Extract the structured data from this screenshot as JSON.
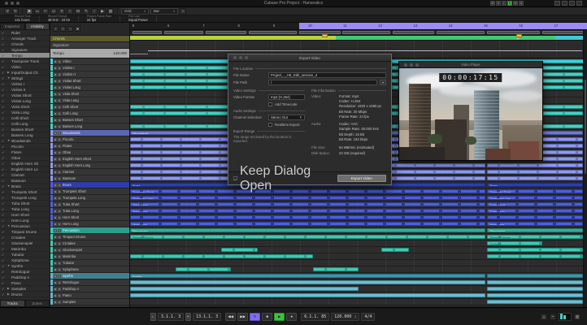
{
  "titlebar": {
    "title": "Cubase Pro Project - Hanseatics",
    "letter_buttons": [
      "M",
      "S",
      "L",
      "R",
      "W",
      "A"
    ],
    "active_letter_index": 3
  },
  "toolbar": {
    "tools": [
      {
        "name": "pointer-tool",
        "glyph": "➤"
      },
      {
        "name": "range-tool",
        "glyph": "▭"
      },
      {
        "name": "split-tool",
        "glyph": "✂"
      },
      {
        "name": "glue-tool",
        "glyph": "⊔"
      },
      {
        "name": "erase-tool",
        "glyph": "✕"
      },
      {
        "name": "zoom-tool",
        "glyph": "○"
      },
      {
        "name": "mute-tool",
        "glyph": "M"
      },
      {
        "name": "draw-tool",
        "glyph": "✎"
      },
      {
        "name": "line-tool",
        "glyph": "∕"
      },
      {
        "name": "play-tool",
        "glyph": "▶"
      },
      {
        "name": "color-tool",
        "glyph": "▧"
      }
    ],
    "grid_label": "Grid",
    "grid_type": "Bar",
    "caret": "▾"
  },
  "statusline": {
    "items": [
      {
        "label": "Record Time",
        "value": "141 hours"
      },
      {
        "label": "Record Format",
        "value": "48 kHz - 24 bit"
      },
      {
        "label": "Project Frame Rate",
        "value": "24 fps"
      },
      {
        "label": "Pan Law",
        "value": "Equal Power"
      }
    ]
  },
  "visibility": {
    "tabs": [
      "Inspector",
      "Visibility"
    ],
    "active_tab": 1,
    "check_glyph": "✓",
    "bottom_tabs": [
      "Tracks",
      "Zones"
    ],
    "items": [
      {
        "label": "Ruler"
      },
      {
        "label": "Arranger Track"
      },
      {
        "label": "Chords"
      },
      {
        "label": "Signature"
      },
      {
        "label": "Tempo",
        "selected": true
      },
      {
        "label": "Transpose Track"
      },
      {
        "label": "Video"
      },
      {
        "label": "Input/Output Ch.",
        "arrow": "closed"
      },
      {
        "label": "Strings",
        "arrow": "open"
      },
      {
        "label": "Violins I"
      },
      {
        "label": "Violins II"
      },
      {
        "label": "Violas Short"
      },
      {
        "label": "Violas Long"
      },
      {
        "label": "Viola Short"
      },
      {
        "label": "Viola Long"
      },
      {
        "label": "Celli Short"
      },
      {
        "label": "Celli Long"
      },
      {
        "label": "Basses Short"
      },
      {
        "label": "Basses Long"
      },
      {
        "label": "Woodwinds",
        "arrow": "open"
      },
      {
        "label": "Piccolo"
      },
      {
        "label": "Flutes"
      },
      {
        "label": "Oboe"
      },
      {
        "label": "English Horn Sh"
      },
      {
        "label": "English Horn Lo"
      },
      {
        "label": "Clarinet"
      },
      {
        "label": "Bassoon"
      },
      {
        "label": "Brass",
        "arrow": "open"
      },
      {
        "label": "Trumpets Short"
      },
      {
        "label": "Trumpets Long"
      },
      {
        "label": "Tuba Short"
      },
      {
        "label": "Tuba Long"
      },
      {
        "label": "Horn Short"
      },
      {
        "label": "Horn Long"
      },
      {
        "label": "Percussion",
        "arrow": "open"
      },
      {
        "label": "Timpani Drums"
      },
      {
        "label": "Crotales"
      },
      {
        "label": "Glockenspiel"
      },
      {
        "label": "Marimba"
      },
      {
        "label": "Tubular"
      },
      {
        "label": "Xylophone"
      },
      {
        "label": "Synths",
        "arrow": "open"
      },
      {
        "label": "Retrologue"
      },
      {
        "label": "Padshop A"
      },
      {
        "label": "Piano"
      },
      {
        "label": "Samples",
        "arrow": "closed"
      },
      {
        "label": "Drums",
        "arrow": "closed"
      }
    ]
  },
  "special": {
    "chords": "Chords",
    "signature": "Signature",
    "tempo_label": "Tempo",
    "tempo_value": "140.000"
  },
  "ruler": {
    "bars": [
      "5",
      "6",
      "7",
      "8",
      "9",
      "10",
      "11",
      "12",
      "13",
      "14",
      "15",
      "16",
      "17"
    ],
    "locator_start_pct": 37
  },
  "arranger_blocks": [
    [
      0.5,
      6.5
    ],
    [
      7.5,
      8.5
    ],
    [
      16.5,
      9
    ],
    [
      26,
      10.5
    ],
    [
      37,
      9
    ],
    [
      46.5,
      10.5
    ],
    [
      57.5,
      9
    ],
    [
      67,
      10.5
    ],
    [
      78.2,
      11.5
    ],
    [
      90.2,
      9
    ]
  ],
  "chord_segments": [
    {
      "start": 0,
      "width": 45,
      "color": "#b9d23c"
    },
    {
      "start": 45,
      "width": 48,
      "color": "#3ecb74"
    },
    {
      "start": 93,
      "width": 6.2,
      "color": "#3cc9d6"
    }
  ],
  "signature_flags_pct": [
    42,
    84.5
  ],
  "tracks": [
    {
      "name": "Video",
      "color": "video",
      "clips": [
        [
          0,
          99.2,
          ""
        ]
      ]
    },
    {
      "name": "Violins I",
      "color": "str",
      "clips": [
        [
          0,
          77.8,
          ""
        ],
        [
          78.2,
          21,
          ""
        ]
      ]
    },
    {
      "name": "Violins II",
      "color": "str",
      "clips": [
        [
          0,
          77.8,
          ""
        ],
        [
          78.2,
          21,
          ""
        ]
      ]
    },
    {
      "name": "Violas Short",
      "color": "str",
      "clips": [
        [
          0,
          77.8,
          ""
        ],
        [
          78.2,
          21,
          ""
        ]
      ]
    },
    {
      "name": "Violas Long",
      "color": "str",
      "clips": [
        [
          0,
          30,
          ""
        ],
        [
          36,
          41.8,
          ""
        ],
        [
          78.2,
          21,
          ""
        ]
      ]
    },
    {
      "name": "Viola Short",
      "color": "str",
      "clips": []
    },
    {
      "name": "Viola Long",
      "color": "str",
      "clips": [
        [
          28,
          6,
          ""
        ]
      ]
    },
    {
      "name": "Celli Short",
      "color": "str",
      "clips": [
        [
          0,
          77.8,
          ""
        ],
        [
          78.2,
          21,
          ""
        ]
      ]
    },
    {
      "name": "Celli Long",
      "color": "str",
      "clips": [
        [
          0,
          77.8,
          ""
        ],
        [
          78.2,
          21,
          ""
        ]
      ]
    },
    {
      "name": "Basses Short",
      "color": "str",
      "clips": []
    },
    {
      "name": "Basses Long",
      "color": "str",
      "clips": [
        [
          0,
          77.8,
          ""
        ],
        [
          78.2,
          21,
          ""
        ]
      ]
    },
    {
      "name": "Woodwinds",
      "color": "wood",
      "group": true,
      "clips": [
        [
          0,
          77.8,
          "Woodwinds"
        ],
        [
          78.2,
          21,
          ""
        ]
      ]
    },
    {
      "name": "Piccolo",
      "color": "wood",
      "clips": [
        [
          0,
          77.8,
          ""
        ],
        [
          78.2,
          21,
          ""
        ]
      ]
    },
    {
      "name": "Flutes",
      "color": "wood",
      "clips": [
        [
          0,
          77.8,
          ""
        ],
        [
          78.2,
          21,
          ""
        ]
      ]
    },
    {
      "name": "Oboe",
      "color": "wood",
      "clips": [
        [
          0,
          77.8,
          ""
        ],
        [
          78.2,
          21,
          ""
        ]
      ]
    },
    {
      "name": "English Horn Short",
      "color": "wood",
      "clips": [
        [
          0,
          77.8,
          ""
        ],
        [
          78.2,
          21,
          ""
        ]
      ]
    },
    {
      "name": "English Horn Long",
      "color": "wood",
      "clips": [
        [
          0,
          77.8,
          ""
        ],
        [
          78.2,
          21,
          ""
        ]
      ]
    },
    {
      "name": "Clarinet",
      "color": "wood",
      "clips": [
        [
          0,
          77.8,
          ""
        ],
        [
          78.2,
          21,
          ""
        ]
      ]
    },
    {
      "name": "Bassoon",
      "color": "wood",
      "clips": [
        [
          0,
          77.8,
          ""
        ],
        [
          78.2,
          21,
          ""
        ]
      ]
    },
    {
      "name": "Brass",
      "color": "brass",
      "group": true,
      "clips": [
        [
          0,
          77.8,
          "Brass"
        ],
        [
          78.2,
          21,
          "Brass"
        ]
      ]
    },
    {
      "name": "Trumpets Short",
      "color": "brass",
      "clips": [
        [
          0,
          77.8,
          "Trumpets Short"
        ],
        [
          78.2,
          21,
          "Trumpets Short"
        ]
      ]
    },
    {
      "name": "Trumpets Long",
      "color": "brass",
      "clips": [
        [
          0,
          77.8,
          "Trumpets Long"
        ],
        [
          78.2,
          21,
          "Trumpets Long"
        ]
      ]
    },
    {
      "name": "Tuba Short",
      "color": "brass",
      "clips": [
        [
          0,
          77.8,
          "Tuba Short"
        ],
        [
          78.2,
          21,
          "Tuba Short"
        ]
      ]
    },
    {
      "name": "Tuba Long",
      "color": "brass",
      "clips": [
        [
          0,
          77.8,
          "Tuba Long"
        ],
        [
          78.2,
          21,
          "Tuba Long"
        ]
      ]
    },
    {
      "name": "Horn Short",
      "color": "brass",
      "clips": [
        [
          0,
          77.8,
          ""
        ],
        [
          78.2,
          21,
          ""
        ]
      ]
    },
    {
      "name": "Horn Long",
      "color": "brass",
      "clips": [
        [
          0,
          77.8,
          "Horn Long"
        ],
        [
          78.2,
          21,
          "Horn Long"
        ]
      ]
    },
    {
      "name": "Percussion",
      "color": "perc",
      "group": true,
      "clips": [
        [
          0,
          77.8,
          "Percussion"
        ],
        [
          78.2,
          21,
          "Percussion"
        ]
      ]
    },
    {
      "name": "Timpani Drums",
      "color": "perc",
      "clips": [
        [
          0,
          77.8,
          "Timpani Drums"
        ],
        [
          78.2,
          21,
          "Timpani Drums"
        ]
      ]
    },
    {
      "name": "Crotales",
      "color": "perc",
      "clips": [
        [
          78.2,
          12,
          "Crotales"
        ]
      ]
    },
    {
      "name": "Glockenspiel",
      "color": "perc",
      "clips": [
        [
          20,
          8,
          ""
        ],
        [
          55,
          6,
          ""
        ],
        [
          78.2,
          21,
          ""
        ]
      ]
    },
    {
      "name": "Marimba",
      "color": "perc",
      "clips": [
        [
          0,
          40,
          ""
        ],
        [
          78.2,
          21,
          ""
        ]
      ]
    },
    {
      "name": "Tubular",
      "color": "perc",
      "clips": []
    },
    {
      "name": "Xylophone",
      "color": "perc",
      "clips": [
        [
          10,
          12,
          ""
        ],
        [
          40,
          10,
          ""
        ]
      ]
    },
    {
      "name": "Synths",
      "color": "syn",
      "group": true,
      "clips": [
        [
          0,
          77.8,
          "Synths"
        ],
        [
          78.2,
          21,
          ""
        ]
      ]
    },
    {
      "name": "Retrologue",
      "color": "syn",
      "clips": [
        [
          0,
          77.8,
          ""
        ],
        [
          78.2,
          21,
          ""
        ]
      ]
    },
    {
      "name": "Padshop A",
      "color": "syn",
      "clips": [
        [
          0,
          50,
          ""
        ],
        [
          78.2,
          21,
          ""
        ]
      ]
    },
    {
      "name": "Piano",
      "color": "syn",
      "clips": [
        [
          0,
          77.8,
          ""
        ],
        [
          78.2,
          21,
          ""
        ]
      ]
    },
    {
      "name": "Samples",
      "color": "syn",
      "clips": [
        [
          78.2,
          21,
          ""
        ]
      ]
    }
  ],
  "dialog": {
    "title": "Export Video",
    "file_location_label": "File Location",
    "file_name_label": "File Name",
    "file_name_value": "Project_-_HS_Edit_session_4",
    "file_path_label": "File Path",
    "file_path_value": "/",
    "video_settings_label": "Video Settings",
    "video_format_label": "Video Format",
    "video_format_value": "mp4 (H.264)",
    "add_timecode_label": "Add Timecode",
    "add_timecode_checked": false,
    "audio_settings_label": "Audio Settings",
    "channel_selection_label": "Channel Selection",
    "channel_selection_value": "Stereo Out",
    "realtime_export_label": "Realtime Export",
    "realtime_export_checked": false,
    "export_range_label": "Export Range",
    "export_range_text": "The range enclosed by the locators is exported.",
    "file_information_label": "File Information",
    "video_info_label": "Video:",
    "video_info_rows": [
      "Format: mp4",
      "Codec: H.264",
      "Resolution: 1920 x 1080 px",
      "Bit Rate: 20 Mbps",
      "Frame Rate: 24 fps"
    ],
    "audio_info_label": "Audio:",
    "audio_info_rows": [
      "Codec: AAC",
      "Sample Rate: 48.000 kHz",
      "Bit Depth: 16 Bit",
      "Bit Rate: 192 kbps"
    ],
    "file_size_label": "File Size:",
    "file_size_value": "64 MB/min (estimated)",
    "disk_space_label": "Disk Space:",
    "disk_space_value": "24 GB (required)",
    "keep_dialog_label": "Keep Dialog Open",
    "keep_dialog_checked": true,
    "export_button": "Export Video",
    "check_glyph": "✓",
    "caret": "▼"
  },
  "video_player": {
    "title": "Video Player",
    "timecode": "00:00:17:15"
  },
  "transport": {
    "left_locator": "3.1.1. 3",
    "right_locator": "13.1.1. 3",
    "l_tag": "L",
    "r_tag": "R",
    "buttons": [
      {
        "name": "to-start-button",
        "glyph": "◀◀"
      },
      {
        "name": "forward-button",
        "glyph": "▶▶"
      },
      {
        "name": "cycle-button",
        "glyph": "↻",
        "cls": "cycle"
      },
      {
        "name": "stop-button",
        "glyph": "■"
      },
      {
        "name": "play-button",
        "glyph": "▶",
        "cls": "play"
      },
      {
        "name": "record-button",
        "glyph": "●"
      }
    ],
    "position": "6.1.1. 85",
    "tempo": "120.000",
    "tempo_unit": "♩",
    "time_signature": "4/4"
  }
}
